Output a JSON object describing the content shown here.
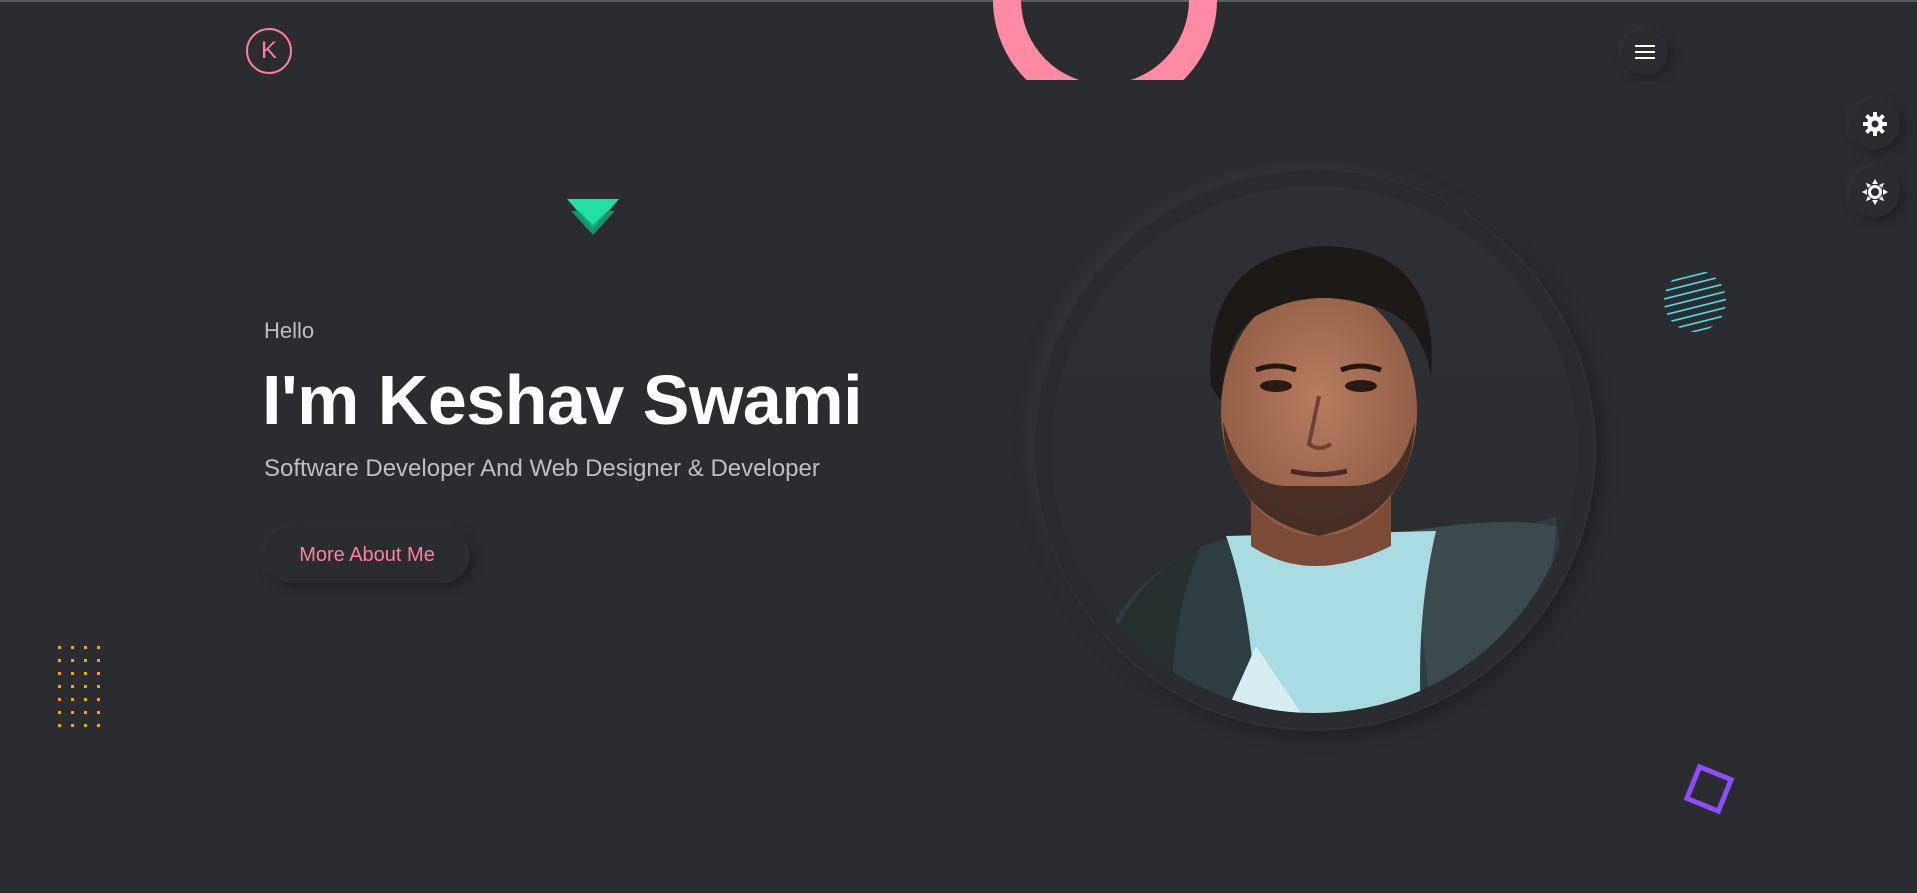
{
  "header": {
    "logo_letter": "K",
    "menu_icon": "hamburger-icon",
    "side_controls": [
      "gear-icon",
      "sun-icon"
    ]
  },
  "hero": {
    "greeting": "Hello",
    "name": "I'm Keshav Swami",
    "tagline": "Software Developer And Web Designer & Developer",
    "cta_label": "More About Me"
  },
  "colors": {
    "background": "#2b2c2f",
    "accent_pink": "#ff7e9c",
    "accent_green": "#1fd89a",
    "accent_cyan": "#4fd6e0",
    "accent_purple": "#8a4dff",
    "accent_orange": "#f5a31a"
  }
}
